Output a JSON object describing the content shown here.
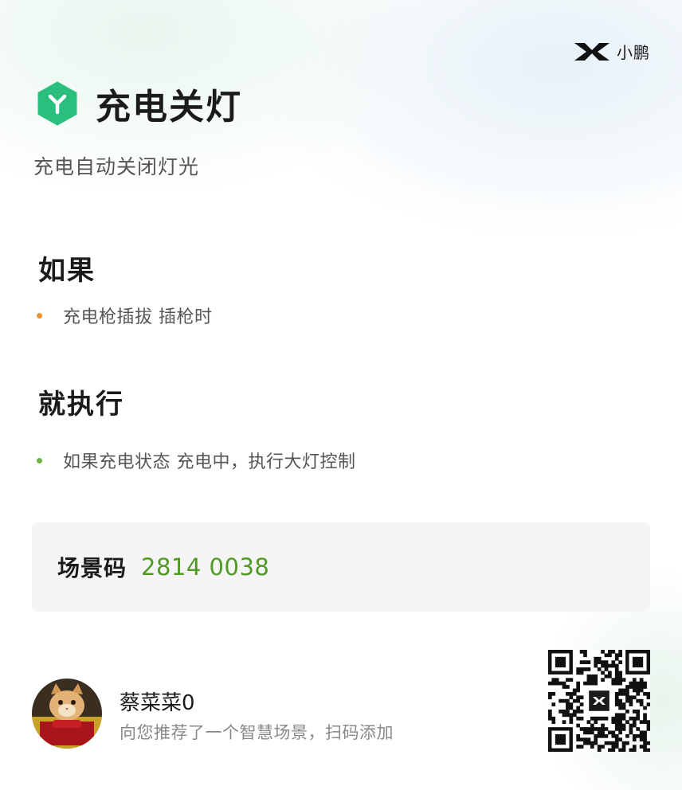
{
  "brand": {
    "name": "小鹏",
    "icon": "xpeng-logo-icon"
  },
  "scene": {
    "icon": "scene-hexagon-icon",
    "icon_color": "#2bbf7e",
    "title": "充电关灯",
    "description": "充电自动关闭灯光"
  },
  "condition": {
    "heading": "如果",
    "bullet_color": "#f0922e",
    "item": "充电枪插拔 插枪时"
  },
  "action": {
    "heading": "就执行",
    "bullet_color": "#6ab344",
    "item": "如果充电状态  充电中，执行大灯控制"
  },
  "scene_code": {
    "label": "场景码",
    "value": "2814 0038",
    "value_color": "#4f9a23"
  },
  "share": {
    "avatar": "cat-avatar",
    "user_name": "蔡菜菜0",
    "message": "向您推荐了一个智慧场景，扫码添加"
  },
  "qr_code": {
    "icon": "qr-code-icon",
    "center_icon": "xpeng-logo-icon"
  }
}
